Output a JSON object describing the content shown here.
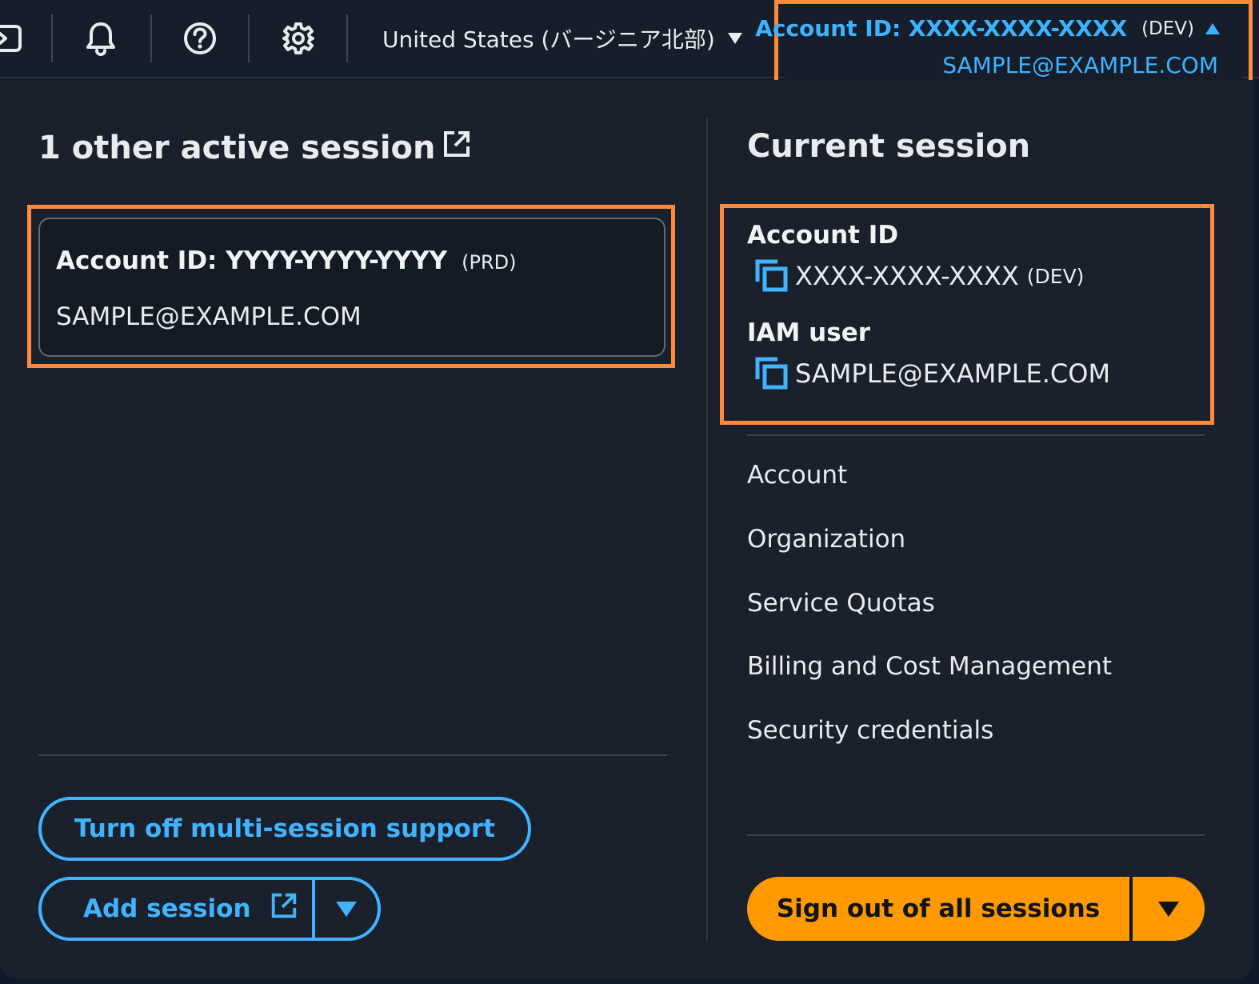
{
  "topbar": {
    "icons": [
      "cloudshell-icon",
      "bell-icon",
      "help-icon",
      "gear-icon"
    ],
    "region_label": "United States (バージニア北部)",
    "account": {
      "id_label": "Account ID: XXXX-XXXX-XXXX",
      "env": "(DEV)",
      "email": "SAMPLE@EXAMPLE.COM"
    }
  },
  "other_sessions": {
    "title": "1 other active session",
    "sessions": [
      {
        "id_label": "Account ID: YYYY-YYYY-YYYY",
        "env": "(PRD)",
        "email": "SAMPLE@EXAMPLE.COM"
      }
    ],
    "turn_off_label": "Turn off multi-session support",
    "add_session_label": "Add session"
  },
  "current_session": {
    "title": "Current session",
    "account_id_label": "Account ID",
    "account_id_value": "XXXX-XXXX-XXXX",
    "account_env": "(DEV)",
    "iam_user_label": "IAM user",
    "iam_user_value": "SAMPLE@EXAMPLE.COM",
    "links": [
      "Account",
      "Organization",
      "Service Quotas",
      "Billing and Cost Management",
      "Security credentials"
    ],
    "sign_out_label": "Sign out of all sessions"
  },
  "colors": {
    "highlight": "#ff8a3d",
    "link_blue": "#42b4ff",
    "primary_orange": "#ff9900",
    "panel_bg": "#1a212c",
    "topbar_bg": "#161e2b"
  }
}
